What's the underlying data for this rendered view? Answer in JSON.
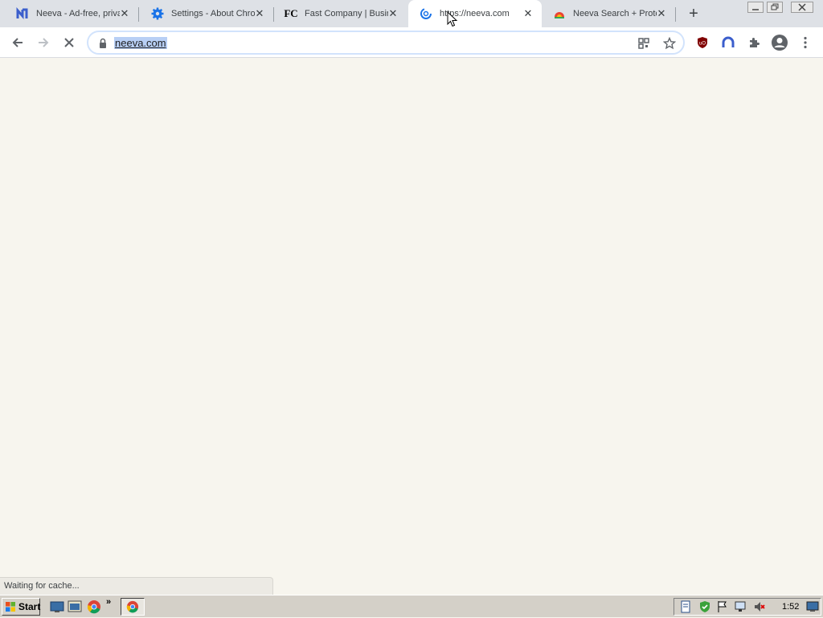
{
  "tabs": [
    {
      "title": "Neeva - Ad-free, private search",
      "favicon": "neeva-icon",
      "active": false
    },
    {
      "title": "Settings - About Chrome",
      "favicon": "gear-icon",
      "active": false
    },
    {
      "title": "Fast Company | Business",
      "favicon": "fc-logo-icon",
      "active": false
    },
    {
      "title": "https://neeva.com",
      "favicon": "loading-icon",
      "active": true
    },
    {
      "title": "Neeva Search + Protect",
      "favicon": "chrome-store-icon",
      "active": false
    }
  ],
  "fc_logo_text": "FC",
  "toolbar": {
    "url": "neeva.com"
  },
  "status_text": "Waiting for cache...",
  "taskbar": {
    "start_label": "Start",
    "clock": "1:52"
  },
  "colors": {
    "accent": "#1a73e8",
    "page_bg": "#f7f5ee",
    "url_highlight": "#b8cff5"
  }
}
